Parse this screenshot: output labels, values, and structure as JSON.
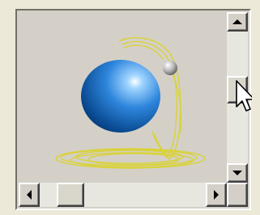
{
  "view": {
    "name": "3d-scene-view",
    "objects": [
      "sphere",
      "small-ball",
      "yellow-helix-path"
    ]
  },
  "scrollbars": {
    "vertical": {
      "up_icon": "arrow-up",
      "down_icon": "arrow-down",
      "position": 0.45
    },
    "horizontal": {
      "left_icon": "arrow-left",
      "right_icon": "arrow-right",
      "position": 0.12
    }
  },
  "colors": {
    "background": "#d4d0c8",
    "sphere": "#1f6fc0",
    "path": "#e0d83a",
    "scrollbar_track": "#e7e6df"
  },
  "cursor_icon": "arrow-pointer"
}
